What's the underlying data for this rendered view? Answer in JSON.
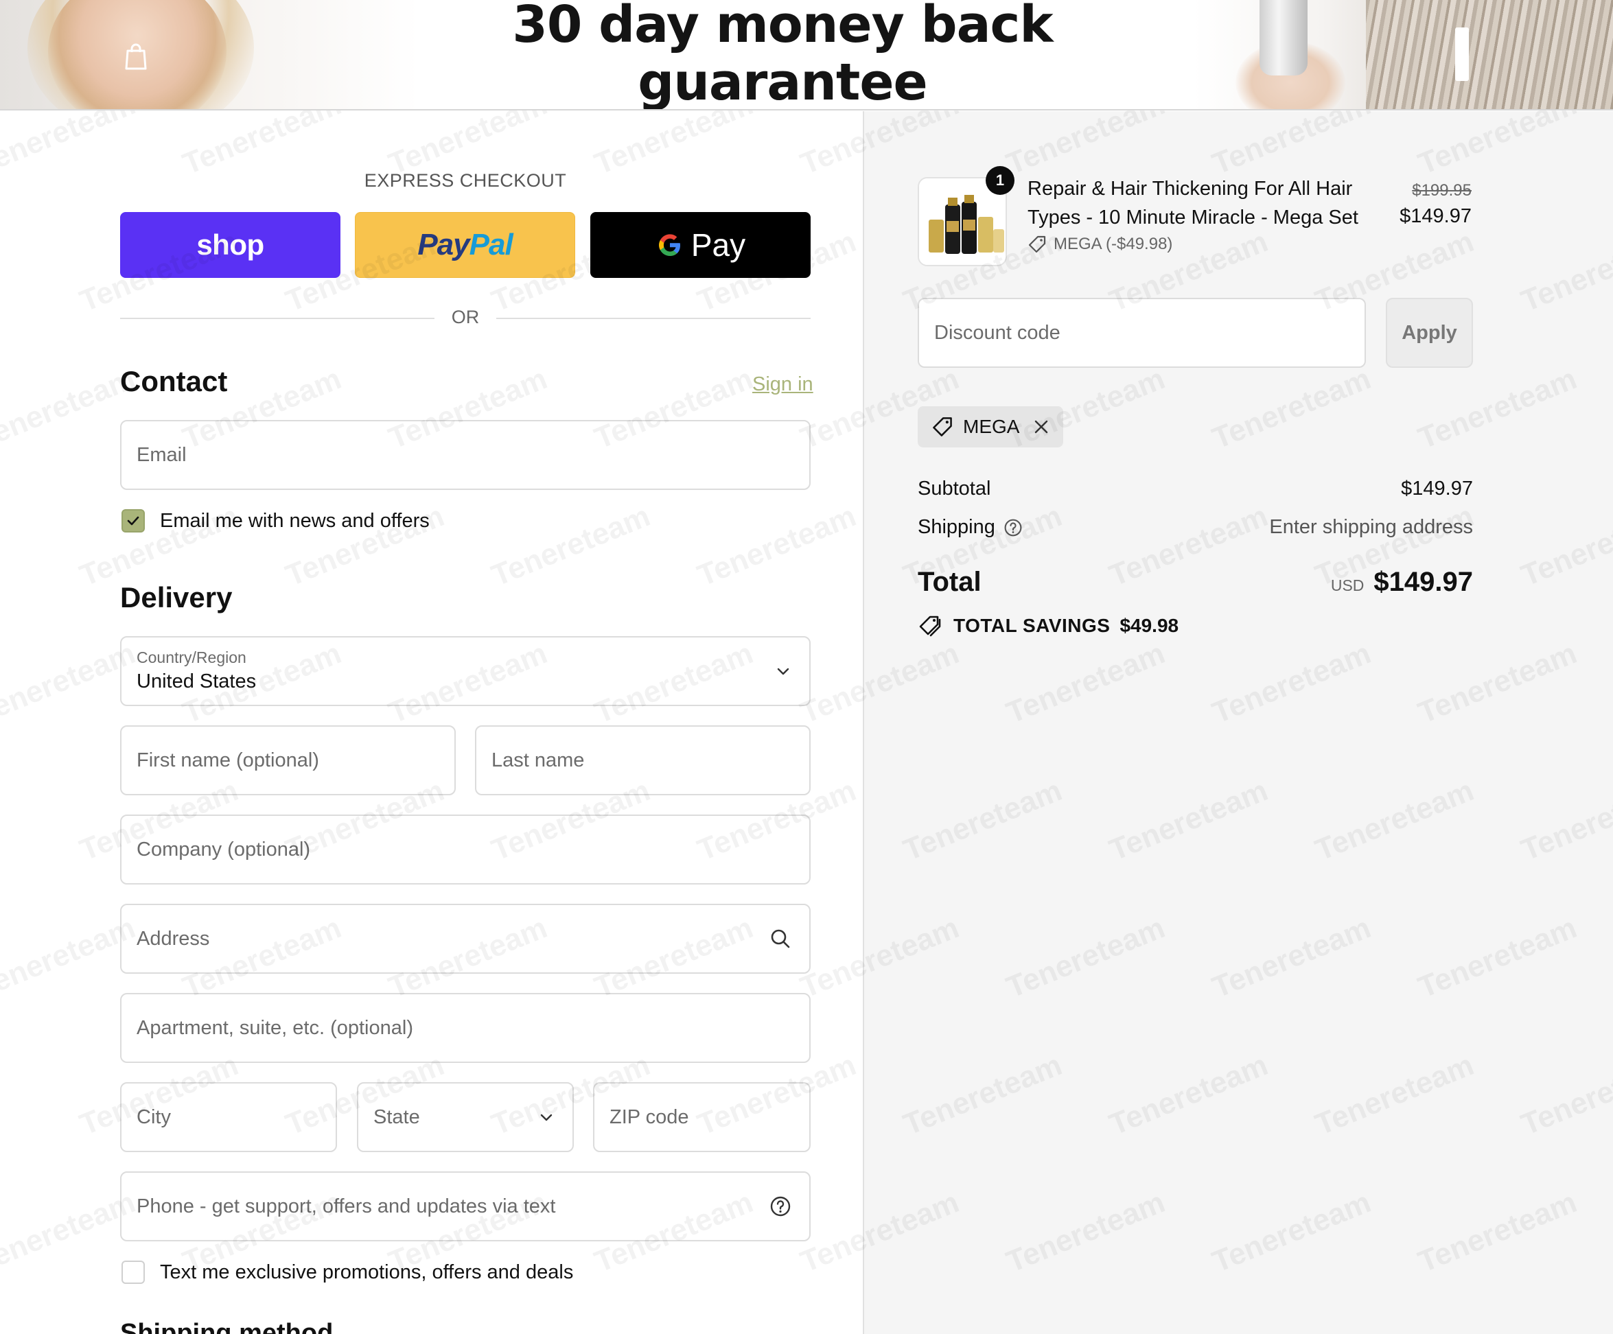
{
  "banner": {
    "headline_line1": "30 day money back",
    "headline_line2": "guarantee",
    "watermark": "Tenereteam"
  },
  "express": {
    "title": "EXPRESS CHECKOUT",
    "shop_label": "shop",
    "paypal_label_1": "Pay",
    "paypal_label_2": "Pal",
    "gpay_g": "G",
    "gpay_label": "Pay",
    "or": "OR"
  },
  "contact": {
    "title": "Contact",
    "sign_in": "Sign in",
    "email_placeholder": "Email",
    "news_label": "Email me with news and offers",
    "news_checked": true
  },
  "delivery": {
    "title": "Delivery",
    "country_label": "Country/Region",
    "country_value": "United States",
    "first_name_placeholder": "First name (optional)",
    "last_name_placeholder": "Last name",
    "company_placeholder": "Company (optional)",
    "address_placeholder": "Address",
    "apartment_placeholder": "Apartment, suite, etc. (optional)",
    "city_placeholder": "City",
    "state_placeholder": "State",
    "zip_placeholder": "ZIP code",
    "phone_placeholder": "Phone - get support, offers and updates via text",
    "sms_label": "Text me exclusive promotions, offers and deals",
    "sms_checked": false,
    "next_section_title": "Shipping method"
  },
  "summary": {
    "item": {
      "quantity": "1",
      "title": "Repair & Hair Thickening For All Hair Types - 10 Minute Miracle - Mega Set",
      "discount_line": "MEGA (-$49.98)",
      "price_original": "$199.95",
      "price_final": "$149.97"
    },
    "discount_placeholder": "Discount code",
    "apply_label": "Apply",
    "applied_code": "MEGA",
    "subtotal_label": "Subtotal",
    "subtotal_value": "$149.97",
    "shipping_label": "Shipping",
    "shipping_value": "Enter shipping address",
    "total_label": "Total",
    "currency": "USD",
    "total_value": "$149.97",
    "savings_label": "TOTAL SAVINGS",
    "savings_value": "$49.98"
  },
  "colors": {
    "shop": "#5a31f4",
    "paypal": "#f8c34d",
    "gpay": "#000000",
    "accent": "#a9b47a"
  }
}
